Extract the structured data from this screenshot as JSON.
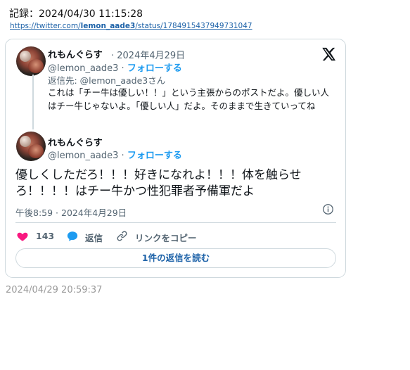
{
  "record": {
    "label": "記録：2024/04/30 11:15:28",
    "url_prefix": "https://twitter.com/",
    "url_user": "lemon_aade3",
    "url_suffix": "/status/1784915437949731047"
  },
  "reply_tweet": {
    "display_name": "れもんぐらす",
    "date": "· 2024年4月29日",
    "handle": "@lemon_aade3 · ",
    "follow": "フォローする",
    "reply_to": "返信先: @lemon_aade3さん",
    "text": "これは「チー牛は優しい！！」という主張からのポストだよ。優しい人はチー牛じゃないよ。「優しい人」だよ。そのままで生きていってね"
  },
  "main_tweet": {
    "display_name": "れもんぐらす",
    "handle": "@lemon_aade3 · ",
    "follow": "フォローする",
    "text": "優しくしただろ！！！好きになれよ！！！体を触らせろ！！！！はチー牛かつ性犯罪者予備軍だよ",
    "timestamp": "午後8:59 · 2024年4月29日"
  },
  "actions": {
    "likes": "143",
    "reply": "返信",
    "copy_link": "リンクをコピー",
    "like_color": "#f91880",
    "reply_color": "#1d9bf0"
  },
  "read_replies": "1件の返信を読む",
  "footer_timestamp": "2024/04/29 20:59:37",
  "icons": [
    "x-logo-icon",
    "info-icon",
    "heart-icon",
    "speech-bubble-icon",
    "link-icon"
  ]
}
